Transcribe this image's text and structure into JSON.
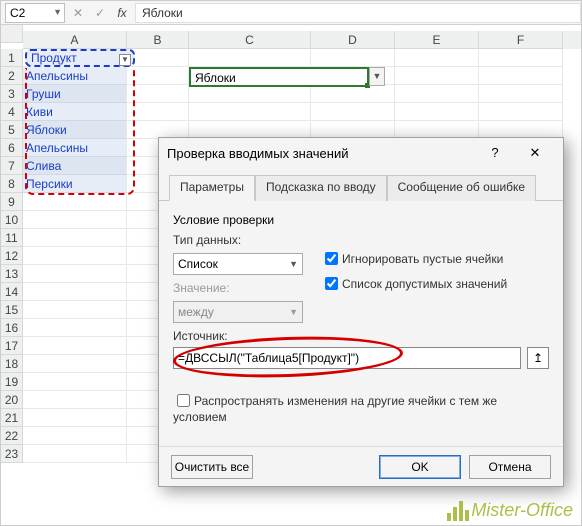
{
  "name_box": "C2",
  "formula_value": "Яблоки",
  "columns": [
    "A",
    "B",
    "C",
    "D",
    "E",
    "F"
  ],
  "rows": [
    "1",
    "2",
    "3",
    "4",
    "5",
    "6",
    "7",
    "8",
    "9",
    "10",
    "11",
    "12",
    "13",
    "14",
    "15",
    "16",
    "17",
    "18",
    "19",
    "20",
    "21",
    "22",
    "23"
  ],
  "table_header": "Продукт",
  "table_data": [
    "Апельсины",
    "Груши",
    "Киви",
    "Яблоки",
    "Апельсины",
    "Слива",
    "Персики"
  ],
  "selected_cell_value": "Яблоки",
  "dialog": {
    "title": "Проверка вводимых значений",
    "tabs": [
      "Параметры",
      "Подсказка по вводу",
      "Сообщение об ошибке"
    ],
    "group": "Условие проверки",
    "type_label": "Тип данных:",
    "type_value": "Список",
    "value_label": "Значение:",
    "value_value": "между",
    "ignore_empty": "Игнорировать пустые ячейки",
    "list_allowed": "Список допустимых значений",
    "source_label": "Источник:",
    "source_value": "=ДВССЫЛ(\"Таблица5[Продукт]\")",
    "apply_same": "Распространять изменения на другие ячейки с тем же условием",
    "clear": "Очистить все",
    "ok": "OK",
    "cancel": "Отмена"
  },
  "watermark": "Mister-Office"
}
